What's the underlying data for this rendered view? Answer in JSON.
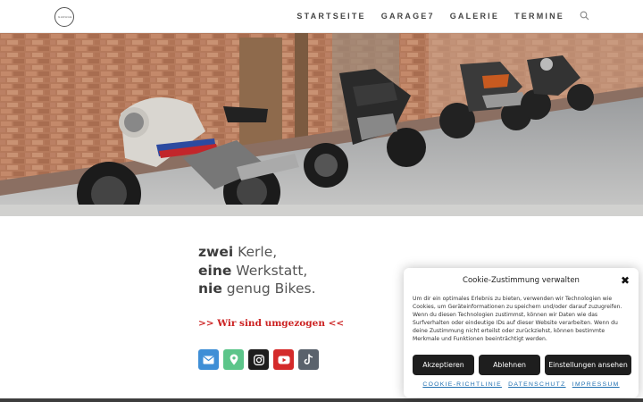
{
  "header": {
    "logo_text": "GARAGE",
    "nav": [
      "STARTSEITE",
      "GARAGE7",
      "GALERIE",
      "TERMINE"
    ]
  },
  "hero": {
    "icon": "motorcycles-photo"
  },
  "tagline": {
    "line1_bold": "zwei",
    "line1_rest": " Kerle,",
    "line2_bold": "eine",
    "line2_rest": " Werkstatt,",
    "line3_bold": "nie",
    "line3_rest": " genug Bikes."
  },
  "moved_link": ">> Wir sind umgezogen <<",
  "socials": [
    {
      "icon": "mail-icon",
      "color": "#3f8fd6"
    },
    {
      "icon": "map-pin-icon",
      "color": "#5cc58a"
    },
    {
      "icon": "instagram-icon",
      "color": "#1d1d1d"
    },
    {
      "icon": "youtube-icon",
      "color": "#d42a2a"
    },
    {
      "icon": "tiktok-icon",
      "color": "#5a626c"
    }
  ],
  "cookie": {
    "title": "Cookie-Zustimmung verwalten",
    "close": "✖",
    "text": "Um dir ein optimales Erlebnis zu bieten, verwenden wir Technologien wie Cookies, um Geräteinformationen zu speichern und/oder darauf zuzugreifen. Wenn du diesen Technologien zustimmst, können wir Daten wie das Surfverhalten oder eindeutige IDs auf dieser Website verarbeiten. Wenn du deine Zustimmung nicht erteilst oder zurückziehst, können bestimmte Merkmale und Funktionen beeinträchtigt werden.",
    "accept": "Akzeptieren",
    "reject": "Ablehnen",
    "settings": "Einstellungen ansehen",
    "links": [
      "COOKIE-RICHTLINIE",
      "DATENSCHUTZ",
      "IMPRESSUM"
    ]
  },
  "colors": {
    "accent_red": "#cc2222",
    "link_blue": "#1f6fb0",
    "button_dark": "#1e1e1e"
  }
}
